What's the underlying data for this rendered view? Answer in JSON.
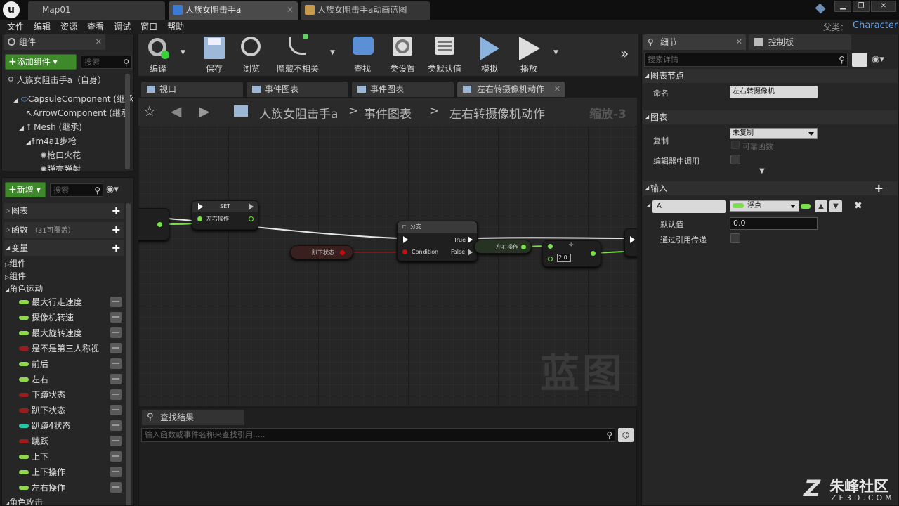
{
  "window_tabs": [
    {
      "label": "Map01"
    },
    {
      "label": "人族女阻击手a"
    },
    {
      "label": "人族女阻击手a动画蓝图"
    }
  ],
  "parent_label": "父类：",
  "parent_class": "Character",
  "menu": [
    "文件",
    "编辑",
    "资源",
    "查看",
    "调试",
    "窗口",
    "帮助"
  ],
  "components": {
    "tab": "组件",
    "add_button": "添加组件",
    "search_placeholder": "搜索",
    "tree": [
      "人族女阻击手a（自身）",
      "CapsuleComponent (继承",
      "ArrowComponent (继承",
      "Mesh (继承)",
      "m4a1步枪",
      "枪口火花",
      "弹壳弹射"
    ]
  },
  "my_blueprint": {
    "new_button": "新增",
    "search_placeholder": "搜索",
    "sections": {
      "graphs": "图表",
      "functions": "函数",
      "functions_count": "（31可覆盖）",
      "variables": "变量"
    },
    "categories": {
      "components1": "组件",
      "components2": "组件",
      "movement": "角色运动",
      "attack": "角色攻击"
    },
    "variables": [
      {
        "name": "最大行走速度",
        "color": "#8fd84a"
      },
      {
        "name": "摄像机转速",
        "color": "#8fd84a"
      },
      {
        "name": "最大旋转速度",
        "color": "#8fd84a"
      },
      {
        "name": "是不是第三人称视",
        "color": "#9a1c1c"
      },
      {
        "name": "前后",
        "color": "#8fd84a"
      },
      {
        "name": "左右",
        "color": "#8fd84a"
      },
      {
        "name": "下蹲状态",
        "color": "#9a1c1c"
      },
      {
        "name": "趴下状态",
        "color": "#9a1c1c"
      },
      {
        "name": "趴蹲4状态",
        "color": "#23c4a8"
      },
      {
        "name": "跳跃",
        "color": "#9a1c1c"
      },
      {
        "name": "上下",
        "color": "#8fd84a"
      },
      {
        "name": "上下操作",
        "color": "#8fd84a"
      },
      {
        "name": "左右操作",
        "color": "#8fd84a"
      }
    ]
  },
  "toolbar": {
    "compile": "编译",
    "save": "保存",
    "browse": "浏览",
    "hide_unrelated": "隐藏不相关",
    "find": "查找",
    "class_settings": "类设置",
    "class_defaults": "类默认值",
    "simulate": "模拟",
    "play": "播放"
  },
  "graph_tabs": [
    "视口",
    "事件图表",
    "事件图表",
    "左右转摄像机动作"
  ],
  "breadcrumb": {
    "blueprint": "人族女阻击手a",
    "sep": ">",
    "graph": "事件图表",
    "func": "左右转摄像机动作",
    "zoom": "缩放-3"
  },
  "graph": {
    "set_node": "SET",
    "set_pin": "左右操作",
    "prone_node": "趴下状态",
    "branch_node": "分支",
    "branch_true": "True",
    "branch_false": "False",
    "branch_cond": "Condition",
    "var_node": "左右操作",
    "mult_value": "2.0",
    "watermark": "蓝图"
  },
  "find_results": {
    "tab": "查找结果",
    "placeholder": "输入函数或事件名称来查找引用....."
  },
  "details": {
    "tab": "细节",
    "tab2": "控制板",
    "search_placeholder": "搜索详情",
    "graph_node_section": "图表节点",
    "name_label": "命名",
    "name_value": "左右转摄像机",
    "graph_section": "图表",
    "replicate_label": "复制",
    "replicate_value": "未复制",
    "reliable_label": "可靠函数",
    "call_in_editor_label": "编辑器中调用",
    "inputs_section": "输入",
    "input_name": "A",
    "input_type": "浮点",
    "default_label": "默认值",
    "default_value": "0.0",
    "by_ref_label": "通过引用传递"
  },
  "watermark": {
    "brand": "朱峰社区",
    "url": "ZF3D.COM"
  },
  "colors": {
    "float_pin": "#7be04a",
    "bool_pin": "#c21010",
    "accent_green": "#3e8a2a"
  }
}
